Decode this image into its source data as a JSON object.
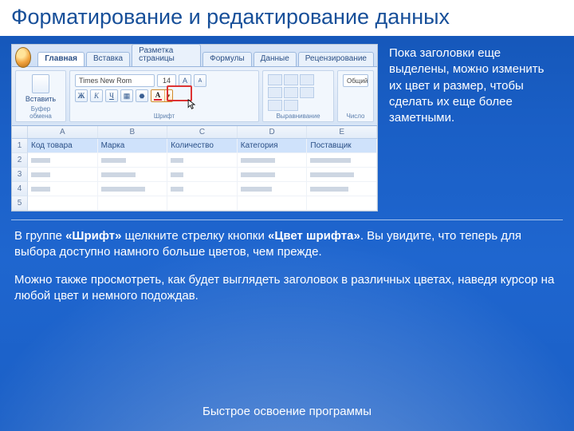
{
  "slide": {
    "title": "Форматирование и редактирование данных",
    "side": "Пока заголовки еще выделены, можно изменить их цвет и размер, чтобы сделать их еще более заметными.",
    "p1a": "В группе ",
    "p1b": "«Шрифт»",
    "p1c": " щелкните стрелку кнопки ",
    "p1d": "«Цвет шрифта»",
    "p1e": ". Вы увидите, что теперь для выбора доступно намного больше цветов, чем прежде.",
    "p2": "Можно также просмотреть, как будет выглядеть заголовок в различных цветах, наведя курсор на любой цвет и немного подождав.",
    "footer": "Быстрое освоение программы"
  },
  "ribbon": {
    "tabs": [
      "Главная",
      "Вставка",
      "Разметка страницы",
      "Формулы",
      "Данные",
      "Рецензирование"
    ],
    "paste": "Вставить",
    "clip": "Буфер обмена",
    "fontname": "Times New Rom",
    "fontsize": "14",
    "fontGroup": "Шрифт",
    "alignGroup": "Выравнивание",
    "numGroup": "Число",
    "numFmt": "Общий"
  },
  "grid": {
    "cols": [
      "A",
      "B",
      "C",
      "D",
      "E"
    ],
    "row1": [
      "Код товара",
      "Марка",
      "Количество",
      "Категория",
      "Поставщик"
    ]
  }
}
